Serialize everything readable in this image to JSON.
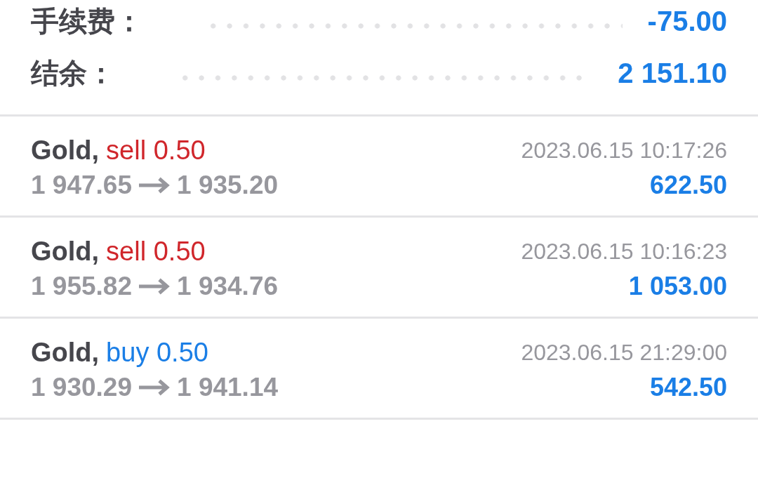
{
  "summary": [
    {
      "label": "手续费：",
      "value": "-75.00"
    },
    {
      "label": "结余：",
      "value": "2 151.10"
    }
  ],
  "trades": [
    {
      "symbol": "Gold,",
      "kind": "sell",
      "order": "sell 0.50",
      "open_price": "1 947.65",
      "close_price": "1 935.20",
      "time": "2023.06.15 10:17:26",
      "profit": "622.50"
    },
    {
      "symbol": "Gold,",
      "kind": "sell",
      "order": "sell 0.50",
      "open_price": "1 955.82",
      "close_price": "1 934.76",
      "time": "2023.06.15 10:16:23",
      "profit": "1 053.00"
    },
    {
      "symbol": "Gold,",
      "kind": "buy",
      "order": "buy 0.50",
      "open_price": "1 930.29",
      "close_price": "1 941.14",
      "time": "2023.06.15 21:29:00",
      "profit": "542.50"
    }
  ]
}
